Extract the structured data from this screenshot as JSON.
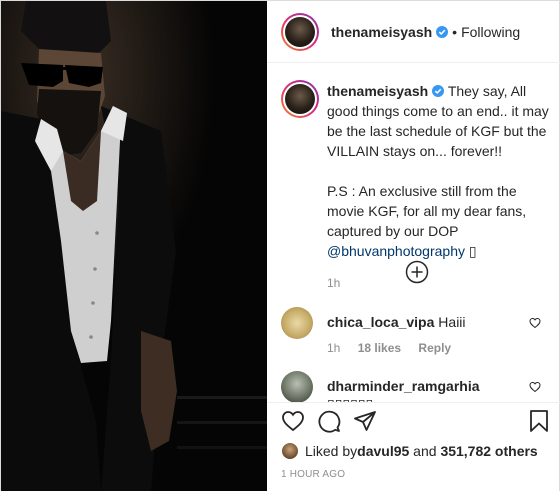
{
  "header": {
    "username": "thenameisyash",
    "separator": "•",
    "follow_state": "Following"
  },
  "caption": {
    "username": "thenameisyash",
    "text": "They say, All good things come to an end.. it may be the last schedule of KGF but the VILLAIN stays on... forever!!",
    "ps_text": "P.S : An exclusive still from the movie KGF, for all my dear fans, captured by our DOP ",
    "mention": "@bhuvanphotography",
    "trailing": " ▯",
    "time": "1h"
  },
  "comments": [
    {
      "username": "chica_loca_vipa",
      "text": "Haiii",
      "time": "1h",
      "likes": "18 likes",
      "reply": "Reply"
    },
    {
      "username": "dharminder_ramgarhia",
      "text": "▯▯▯▯▯▯",
      "time": "",
      "likes": "",
      "reply": ""
    }
  ],
  "likes": {
    "prefix": "Liked by ",
    "liker": "davul95",
    "conjunction": " and ",
    "count": "351,782 others"
  },
  "timestamp": "1 HOUR AGO",
  "colors": {
    "verified_blue": "#3897f0",
    "mention_blue": "#00376b",
    "secondary_gray": "#8e8e8e"
  },
  "icons": {
    "like": "heart-icon",
    "comment": "comment-icon",
    "share": "paper-plane-icon",
    "save": "bookmark-icon",
    "load_more": "plus-circle-icon"
  }
}
